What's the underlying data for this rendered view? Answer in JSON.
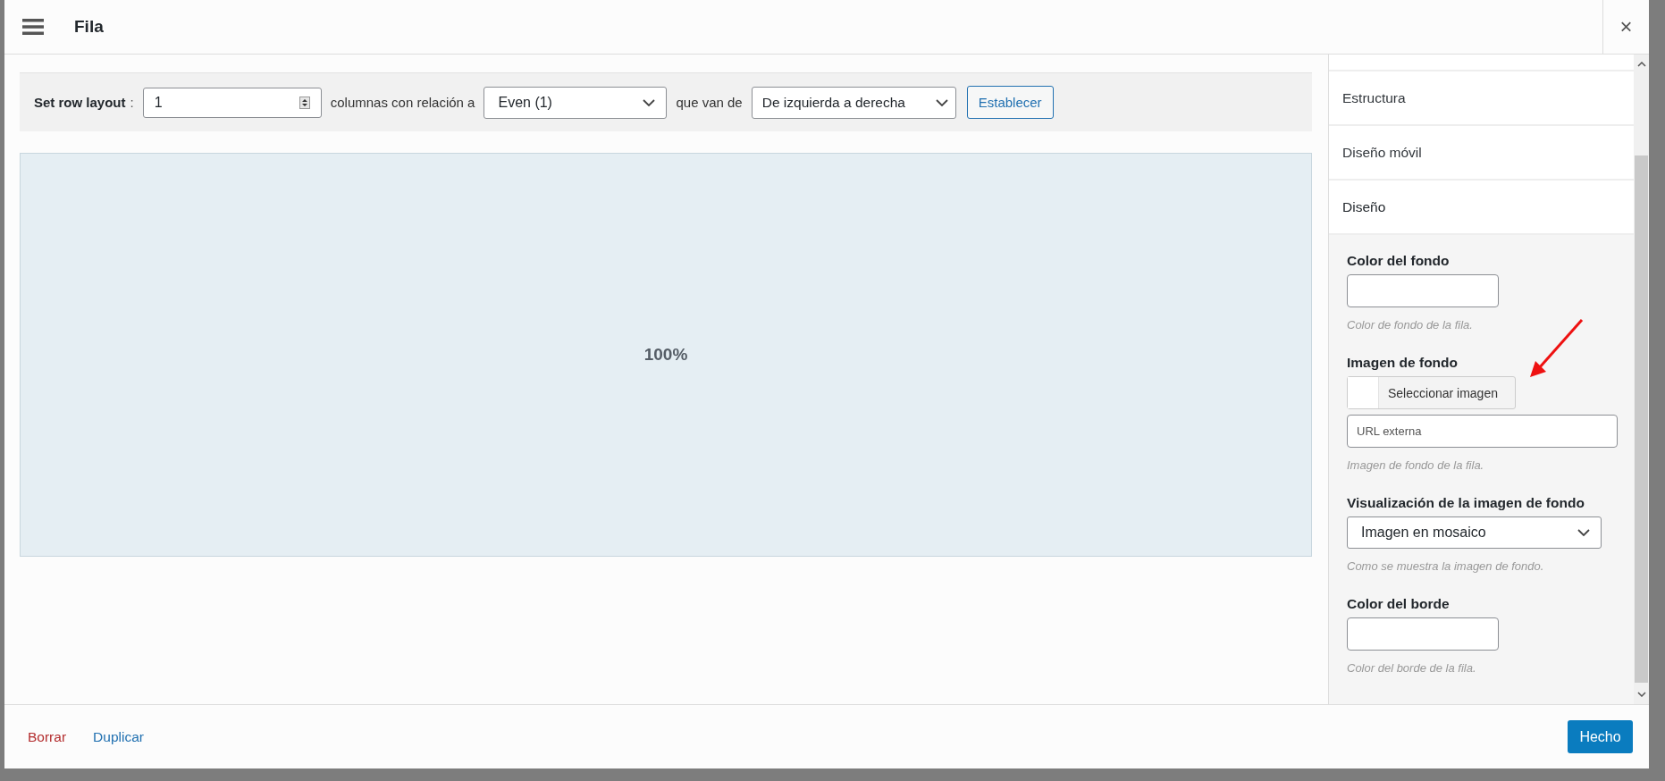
{
  "header": {
    "title": "Fila",
    "close": "×"
  },
  "layout_bar": {
    "label": "Set row layout",
    "separator": ":",
    "columns": {
      "value": "1"
    },
    "relation_label": "columnas con relación a",
    "ratio": {
      "value": "Even (1)"
    },
    "direction_label": "que van de",
    "direction": {
      "value": "De izquierda a derecha"
    },
    "button": "Establecer"
  },
  "preview": {
    "columns": [
      {
        "width_label": "100%"
      }
    ]
  },
  "sidebar": {
    "sections": [
      {
        "label": "Estructura",
        "expanded": false
      },
      {
        "label": "Diseño móvil",
        "expanded": false
      },
      {
        "label": "Diseño",
        "expanded": true
      }
    ],
    "fields": [
      {
        "kind": "color",
        "label": "Color del fondo",
        "help": "Color de fondo de la fila."
      },
      {
        "kind": "image",
        "label": "Imagen de fondo",
        "button": "Seleccionar imagen",
        "placeholder": "URL externa",
        "help": "Imagen de fondo de la fila."
      },
      {
        "kind": "select",
        "label": "Visualización de la imagen de fondo",
        "value": "Imagen en mosaico",
        "help": "Como se muestra la imagen de fondo."
      },
      {
        "kind": "color",
        "label": "Color del borde",
        "help": "Color del borde de la fila."
      }
    ]
  },
  "footer": {
    "delete": "Borrar",
    "duplicate": "Duplicar",
    "done": "Hecho"
  }
}
